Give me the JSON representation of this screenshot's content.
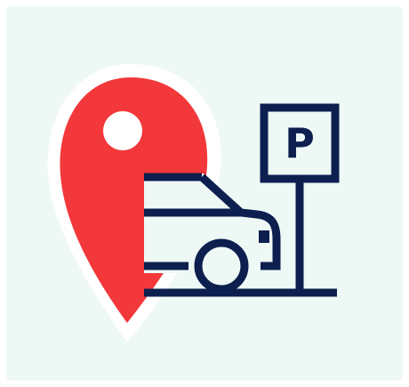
{
  "icon": {
    "name": "parking-location-icon",
    "sign_letter": "P"
  },
  "colors": {
    "background": "#eef9f6",
    "pin": "#f2383a",
    "pin_halo": "#ffffff",
    "line": "#0c1f4f"
  }
}
